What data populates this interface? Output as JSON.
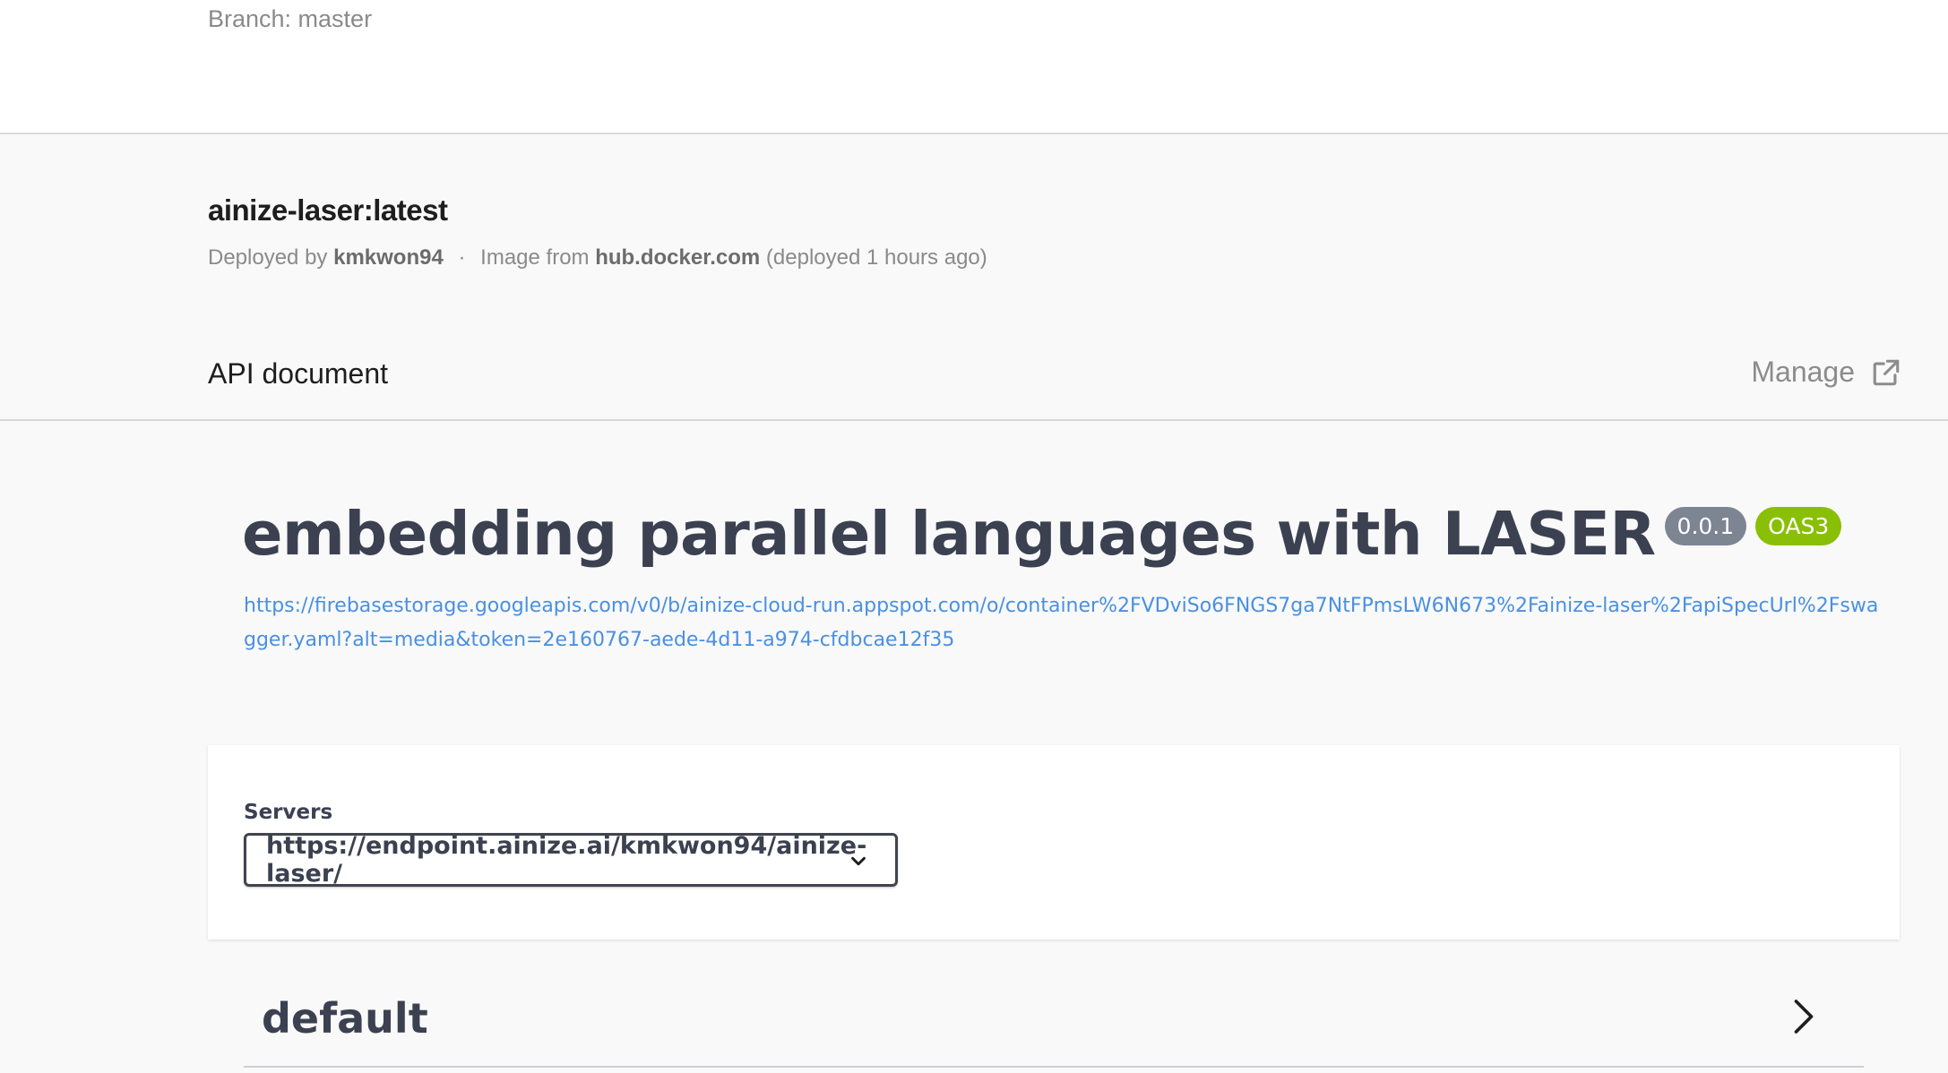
{
  "header": {
    "branch": "Branch: master"
  },
  "container": {
    "title": "ainize-laser:latest",
    "deployed_by_prefix": "Deployed by",
    "deployed_by_user": "kmkwon94",
    "separator": "·",
    "image_from_prefix": "Image from",
    "image_source": "hub.docker.com",
    "deployed_time": "(deployed 1 hours ago)"
  },
  "api_section": {
    "title": "API document",
    "manage_label": "Manage",
    "manage_icon": "external-link-icon"
  },
  "swagger": {
    "title": "embedding parallel languages with LASER",
    "version_badge": "0.0.1",
    "oas_badge": "OAS3",
    "spec_url": "https://firebasestorage.googleapis.com/v0/b/ainize-cloud-run.appspot.com/o/container%2FVDviSo6FNGS7ga7NtFPmsLW6N673%2Fainize-laser%2FapiSpecUrl%2Fswagger.yaml?alt=media&token=2e160767-aede-4d11-a974-cfdbcae12f35",
    "servers_label": "Servers",
    "selected_server": "https://endpoint.ainize.ai/kmkwon94/ainize-laser/",
    "tag_name": "default"
  },
  "colors": {
    "swagger_text": "#3b4151",
    "link": "#4990e2",
    "version_badge": "#7d8492",
    "oas_badge": "#89bf04"
  }
}
